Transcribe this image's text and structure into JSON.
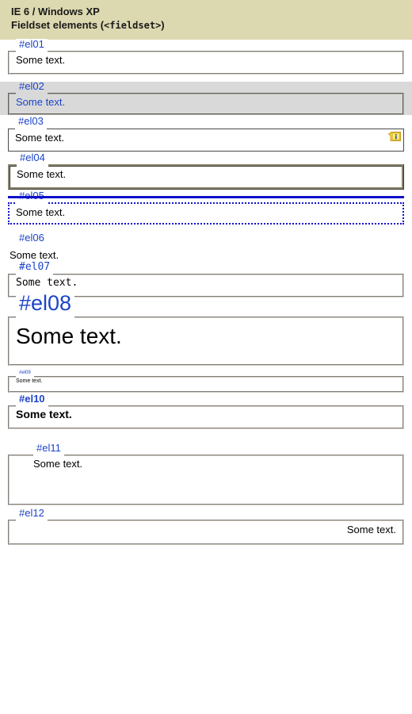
{
  "header": {
    "line1": "IE 6 / Windows XP",
    "line2_prefix": "Fieldset elements (",
    "line2_code": "<fieldset>",
    "line2_suffix": ")",
    "background_color": "#dcd8b0"
  },
  "colors": {
    "page_background": "#ffffff",
    "legend_blue": "#1c44c8",
    "body_text": "#000000",
    "default_border": "#d4d0c8",
    "el02_band": "#d9d9d9",
    "el03_border": "#4a4a4a",
    "el04_border": "#8a8670",
    "el05_border": "#1111cc",
    "info_icon_fill": "#ffd83b",
    "info_icon_stroke": "#c9a227",
    "info_icon_glyph": "#1c44c8"
  },
  "body_text": "Some text.",
  "fieldsets": [
    {
      "id": "el01",
      "legend": "#el01",
      "text": "Some text.",
      "style_note": "default border"
    },
    {
      "id": "el02",
      "legend": "#el02",
      "text": "Some text.",
      "style_note": "gray background, blue text"
    },
    {
      "id": "el03",
      "legend": "#el03",
      "text": "Some text.",
      "style_note": "solid dark border with info marker"
    },
    {
      "id": "el04",
      "legend": "#el04",
      "text": "Some text.",
      "style_note": "thick ridge border"
    },
    {
      "id": "el05",
      "legend": "#el05",
      "text": "Some text.",
      "style_note": "blue dotted border, solid top rule through legend"
    },
    {
      "id": "el06",
      "legend": "#el06",
      "text": "Some text.",
      "style_note": "no border"
    },
    {
      "id": "el07",
      "legend": "#el07",
      "text": "Some text.",
      "style_note": "monospace font"
    },
    {
      "id": "el08",
      "legend": "#el08",
      "text": "Some text.",
      "style_note": "large font size"
    },
    {
      "id": "el09",
      "legend": "#el09",
      "text": "Some text.",
      "style_note": "tiny font size"
    },
    {
      "id": "el10",
      "legend": "#el10",
      "text": "Some text.",
      "style_note": "bold text"
    },
    {
      "id": "el11",
      "legend": "#el11",
      "text": "Some text.",
      "style_note": "large padding"
    },
    {
      "id": "el12",
      "legend": "#el12",
      "text": "Some text.",
      "style_note": "right aligned text"
    }
  ],
  "info_marker": {
    "glyph": "i",
    "name": "info-callout"
  }
}
